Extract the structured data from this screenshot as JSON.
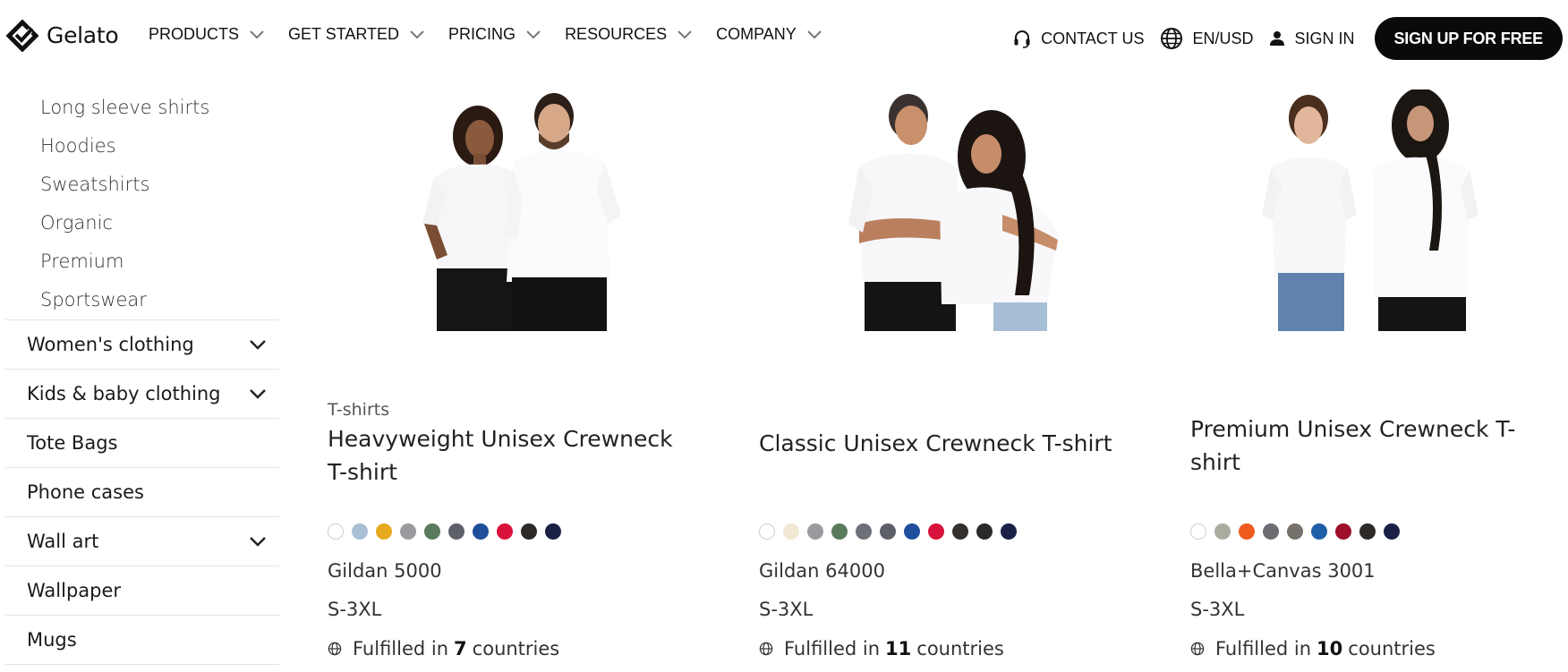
{
  "brand": {
    "name": "Gelato"
  },
  "nav": {
    "items": [
      {
        "label": "PRODUCTS"
      },
      {
        "label": "GET STARTED"
      },
      {
        "label": "PRICING"
      },
      {
        "label": "RESOURCES"
      },
      {
        "label": "COMPANY"
      }
    ],
    "contact_label": "CONTACT US",
    "locale_label": "EN/USD",
    "signin_label": "SIGN IN",
    "signup_label": "SIGN UP FOR FREE"
  },
  "sidebar": {
    "subitems": [
      "Long sleeve shirts",
      "Hoodies",
      "Sweatshirts",
      "Organic",
      "Premium",
      "Sportswear"
    ],
    "categories": [
      {
        "label": "Women's clothing",
        "expandable": true
      },
      {
        "label": "Kids & baby clothing",
        "expandable": true
      },
      {
        "label": "Tote Bags",
        "expandable": false
      },
      {
        "label": "Phone cases",
        "expandable": false
      },
      {
        "label": "Wall art",
        "expandable": true
      },
      {
        "label": "Wallpaper",
        "expandable": false
      },
      {
        "label": "Mugs",
        "expandable": false
      }
    ]
  },
  "products": [
    {
      "category": "T-shirts",
      "title": "Heavyweight Unisex Crewneck T-shirt",
      "colors": [
        "#ffffff",
        "#a9bfd4",
        "#e9a91e",
        "#999b9e",
        "#5a7a5c",
        "#5e6068",
        "#1f4e9b",
        "#d8123a",
        "#2d2a27",
        "#1a2046"
      ],
      "model": "Gildan 5000",
      "sizes": "S-3XL",
      "fulfilled_prefix": "Fulfilled in",
      "countries": "7",
      "fulfilled_suffix": "countries"
    },
    {
      "category": "",
      "title": "Classic Unisex Crewneck T-shirt",
      "colors": [
        "#ffffff",
        "#f1e8d4",
        "#999b9e",
        "#5a7a5c",
        "#6e7077",
        "#5e6068",
        "#1f4e9b",
        "#d8123a",
        "#35302b",
        "#2a2a28",
        "#1a2046"
      ],
      "model": "Gildan 64000",
      "sizes": "S-3XL",
      "fulfilled_prefix": "Fulfilled in",
      "countries": "11",
      "fulfilled_suffix": "countries"
    },
    {
      "category": "",
      "title": "Premium Unisex Crewneck T-shirt",
      "colors": [
        "#ffffff",
        "#a8ada0",
        "#ef5a1f",
        "#6b6d72",
        "#77716c",
        "#1f5ea8",
        "#9e0f2a",
        "#2d2a27",
        "#1a2046"
      ],
      "model": "Bella+Canvas 3001",
      "sizes": "S-3XL",
      "fulfilled_prefix": "Fulfilled in",
      "countries": "10",
      "fulfilled_suffix": "countries"
    }
  ]
}
